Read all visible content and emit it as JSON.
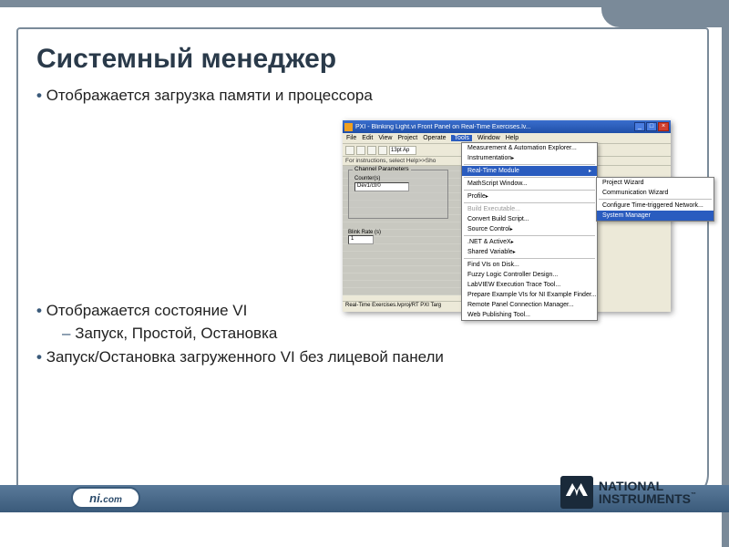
{
  "slide": {
    "title": "Системный менеджер",
    "bullets": {
      "b1": "Отображается загрузка памяти и процессора",
      "b2": "Отображается состояние VI",
      "b2a": "Запуск, Простой, Остановка",
      "b3": "Запуск/Остановка загруженного VI без лицевой панели"
    }
  },
  "app": {
    "title": "PXI - Blinking Light.vi Front Panel on Real-Time Exercises.lv...",
    "menu": {
      "file": "File",
      "edit": "Edit",
      "view": "View",
      "project": "Project",
      "operate": "Operate",
      "tools": "Tools",
      "window": "Window",
      "help": "Help"
    },
    "toolbar": {
      "font": "13pt Ap"
    },
    "instructions": "For instructions, select Help>>Sho",
    "panel": {
      "group_title": "Channel Parameters",
      "counter_label": "Counter(s)",
      "counter_value": "Dev1/ctr0",
      "blink_label": "Blink Rate (s)",
      "blink_value": "1"
    },
    "status": "Real-Time Exercises.lvproj/RT PXI Targ"
  },
  "tools_menu": {
    "i1": "Measurement & Automation Explorer...",
    "i2": "Instrumentation",
    "i3": "Real-Time Module",
    "i4": "MathScript Window...",
    "i5": "Profile",
    "i6": "Build Executable...",
    "i7": "Convert Build Script...",
    "i8": "Source Control",
    "i9": ".NET & ActiveX",
    "i10": "Shared Variable",
    "i11": "Find VIs on Disk...",
    "i12": "Fuzzy Logic Controller Design...",
    "i13": "LabVIEW Execution Trace Tool...",
    "i14": "Prepare Example VIs for NI Example Finder...",
    "i15": "Remote Panel Connection Manager...",
    "i16": "Web Publishing Tool..."
  },
  "rt_submenu": {
    "s1": "Project Wizard",
    "s2": "Communication Wizard",
    "s3": "Configure Time-triggered Network...",
    "s4": "System Manager"
  },
  "footer": {
    "badge1": "ni.",
    "badge2": "com",
    "brand1": "NATIONAL",
    "brand2": "INSTRUMENTS",
    "tm": "™"
  }
}
